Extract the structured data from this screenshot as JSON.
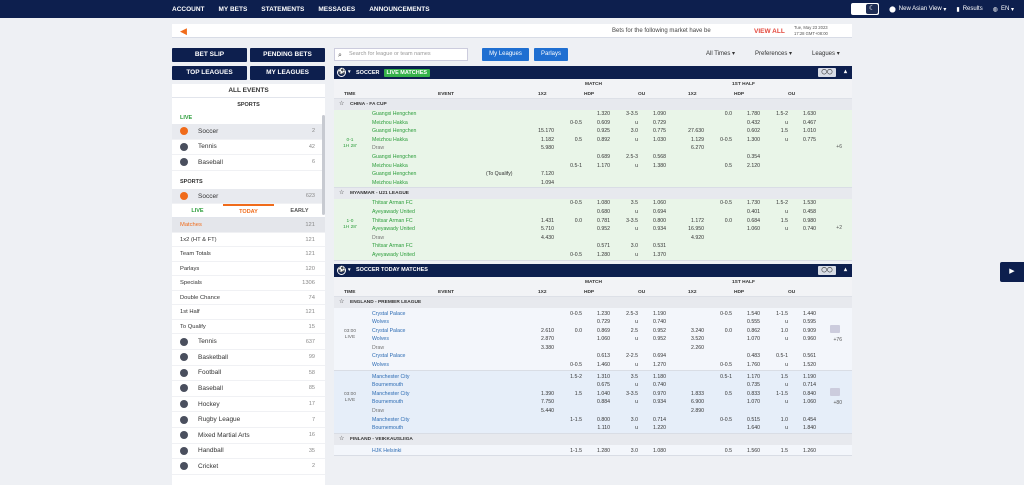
{
  "nav": {
    "items": [
      "ACCOUNT",
      "MY BETS",
      "STATEMENTS",
      "MESSAGES",
      "ANNOUNCEMENTS"
    ]
  },
  "topright": {
    "view": "New Asian View",
    "results": "Results",
    "lang": "EN"
  },
  "notice": {
    "text": "Bets for the following market have be",
    "view_all": "VIEW ALL",
    "date": "Tue, May 23 2023",
    "time": "17:28 GMT+08:00"
  },
  "leftbuttons": {
    "bet_slip": "BET SLIP",
    "pending_bets": "PENDING BETS",
    "top_leagues": "TOP LEAGUES",
    "my_leagues": "MY LEAGUES"
  },
  "filters": {
    "search_placeholder": "Search for league or team names",
    "my_leagues": "My Leagues",
    "parlays": "Parlays",
    "all_times": "All Times",
    "preferences": "Preferences",
    "leagues": "Leagues"
  },
  "sidebar": {
    "all_events": "ALL EVENTS",
    "sports_header": "SPORTS",
    "live_label": "LIVE",
    "live_sports": [
      {
        "name": "Soccer",
        "count": "2"
      },
      {
        "name": "Tennis",
        "count": "42"
      },
      {
        "name": "Baseball",
        "count": "6"
      }
    ],
    "sports_label": "SPORTS",
    "soccer": {
      "name": "Soccer",
      "count": "623"
    },
    "tabs": [
      "LIVE",
      "TODAY",
      "EARLY"
    ],
    "sub": [
      {
        "name": "Matches",
        "count": "121"
      },
      {
        "name": "1x2 (HT & FT)",
        "count": "121"
      },
      {
        "name": "Team Totals",
        "count": "121"
      },
      {
        "name": "Parlays",
        "count": "120"
      },
      {
        "name": "Specials",
        "count": "1306"
      },
      {
        "name": "Double Chance",
        "count": "74"
      },
      {
        "name": "1st Half",
        "count": "121"
      },
      {
        "name": "To Qualify",
        "count": "15"
      }
    ],
    "more_sports": [
      {
        "name": "Tennis",
        "count": "637"
      },
      {
        "name": "Basketball",
        "count": "99"
      },
      {
        "name": "Football",
        "count": "58"
      },
      {
        "name": "Baseball",
        "count": "85"
      },
      {
        "name": "Hockey",
        "count": "17"
      },
      {
        "name": "Rugby League",
        "count": "7"
      },
      {
        "name": "Mixed Martial Arts",
        "count": "16"
      },
      {
        "name": "Handball",
        "count": "35"
      },
      {
        "name": "Cricket",
        "count": "2"
      }
    ]
  },
  "live_section": {
    "title": "SOCCER",
    "badge": "LIVE MATCHES"
  },
  "today_section": {
    "title": "SOCCER TODAY MATCHES"
  },
  "headers": {
    "time": "TIME",
    "event": "EVENT",
    "match": "MATCH",
    "first_half": "1ST HALF",
    "x12": "1X2",
    "hdp": "HDP",
    "ou": "OU"
  },
  "live_leagues": [
    {
      "name": "CHINA - FA CUP",
      "score": "0-1",
      "clock": "1H 28'",
      "more": "+6",
      "rows": [
        [
          "Guangxi Hengchen",
          "",
          "",
          "1.320",
          "3-3.5",
          "1.090",
          "",
          "0.0",
          "1.780",
          "1.5-2",
          "1.630"
        ],
        [
          "Meizhou Hakka",
          "",
          "0-0.5",
          "0.609",
          "u",
          "0.729",
          "",
          "",
          "0.432",
          "u",
          "0.467"
        ],
        [
          "Guangxi Hengchen",
          "15.170",
          "",
          "0.925",
          "3.0",
          "0.775",
          "27.630",
          "",
          "0.602",
          "1.5",
          "1.010"
        ],
        [
          "Meizhou Hakka",
          "1.182",
          "0.5",
          "0.892",
          "u",
          "1.030",
          "1.129",
          "0-0.5",
          "1.300",
          "u",
          "0.775"
        ],
        [
          "Draw",
          "5.980",
          "",
          "",
          "",
          "",
          "6.270",
          "",
          "",
          "",
          ""
        ],
        [
          "Guangxi Hengchen",
          "",
          "",
          "0.689",
          "2.5-3",
          "0.568",
          "",
          "",
          "0.354",
          "",
          ""
        ],
        [
          "Meizhou Hakka",
          "",
          "0.5-1",
          "1.170",
          "u",
          "1.380",
          "",
          "0.5",
          "2.120",
          "",
          ""
        ],
        [
          "Guangxi Hengchen",
          "7.120",
          "",
          "",
          "",
          "",
          "",
          "",
          "",
          "",
          ""
        ],
        [
          "Meizhou Hakka",
          "1.094",
          "",
          "",
          "",
          "",
          "",
          "",
          "",
          "",
          ""
        ]
      ],
      "qualify": "(To Qualify)"
    },
    {
      "name": "MYANMAR - U21 LEAGUE",
      "score": "1-0",
      "clock": "1H 28'",
      "more": "+2",
      "rows": [
        [
          "Thitsar Arman FC",
          "",
          "0-0.5",
          "1.080",
          "3.5",
          "1.060",
          "",
          "0-0.5",
          "1.730",
          "1.5-2",
          "1.530"
        ],
        [
          "Ayeyawady United",
          "",
          "",
          "0.680",
          "u",
          "0.694",
          "",
          "",
          "0.401",
          "u",
          "0.458"
        ],
        [
          "Thitsar Arman FC",
          "1.431",
          "0.0",
          "0.781",
          "3-3.5",
          "0.800",
          "1.172",
          "0.0",
          "0.684",
          "1.5",
          "0.980"
        ],
        [
          "Ayeyawady United",
          "5.710",
          "",
          "0.952",
          "u",
          "0.934",
          "16.950",
          "",
          "1.060",
          "u",
          "0.740"
        ],
        [
          "Draw",
          "4.430",
          "",
          "",
          "",
          "",
          "4.920",
          "",
          "",
          "",
          ""
        ],
        [
          "Thitsar Arman FC",
          "",
          "",
          "0.571",
          "3.0",
          "0.531",
          "",
          "",
          "",
          "",
          ""
        ],
        [
          "Ayeyawady United",
          "",
          "0-0.5",
          "1.280",
          "u",
          "1.370",
          "",
          "",
          "",
          "",
          ""
        ]
      ]
    }
  ],
  "today_leagues": [
    {
      "name": "ENGLAND - PREMIER LEAGUE",
      "groups": [
        {
          "time": "03:00",
          "live": "LIVE",
          "more": "+76",
          "rows": [
            [
              "Crystal Palace",
              "",
              "0-0.5",
              "1.230",
              "2.5-3",
              "1.190",
              "",
              "0-0.5",
              "1.540",
              "1-1.5",
              "1.440"
            ],
            [
              "Wolves",
              "",
              "",
              "0.729",
              "u",
              "0.740",
              "",
              "",
              "0.555",
              "u",
              "0.595"
            ],
            [
              "Crystal Palace",
              "2.610",
              "0.0",
              "0.869",
              "2.5",
              "0.952",
              "3.240",
              "0.0",
              "0.862",
              "1.0",
              "0.909"
            ],
            [
              "Wolves",
              "2.870",
              "",
              "1.060",
              "u",
              "0.952",
              "3.520",
              "",
              "1.070",
              "u",
              "0.960"
            ],
            [
              "Draw",
              "3.380",
              "",
              "",
              "",
              "",
              "2.260",
              "",
              "",
              "",
              ""
            ],
            [
              "Crystal Palace",
              "",
              "",
              "0.613",
              "2-2.5",
              "0.694",
              "",
              "",
              "0.483",
              "0.5-1",
              "0.561"
            ],
            [
              "Wolves",
              "",
              "0-0.5",
              "1.460",
              "u",
              "1.270",
              "",
              "0-0.5",
              "1.760",
              "u",
              "1.520"
            ]
          ]
        },
        {
          "time": "03:00",
          "live": "LIVE",
          "more": "+80",
          "rows": [
            [
              "Manchester City",
              "",
              "1.5-2",
              "1.310",
              "3.5",
              "1.180",
              "",
              "0.5-1",
              "1.170",
              "1.5",
              "1.190"
            ],
            [
              "Bournemouth",
              "",
              "",
              "0.675",
              "u",
              "0.740",
              "",
              "",
              "0.735",
              "u",
              "0.714"
            ],
            [
              "Manchester City",
              "1.390",
              "1.5",
              "1.040",
              "3-3.5",
              "0.970",
              "1.833",
              "0.5",
              "0.833",
              "1-1.5",
              "0.840"
            ],
            [
              "Bournemouth",
              "7.750",
              "",
              "0.884",
              "u",
              "0.934",
              "6.900",
              "",
              "1.070",
              "u",
              "1.060"
            ],
            [
              "Draw",
              "5.440",
              "",
              "",
              "",
              "",
              "2.890",
              "",
              "",
              "",
              ""
            ],
            [
              "Manchester City",
              "",
              "1-1.5",
              "0.800",
              "3.0",
              "0.714",
              "",
              "0-0.5",
              "0.515",
              "1.0",
              "0.454"
            ],
            [
              "Bournemouth",
              "",
              "",
              "1.110",
              "u",
              "1.220",
              "",
              "",
              "1.640",
              "u",
              "1.840"
            ]
          ]
        }
      ]
    },
    {
      "name": "FINLAND - VEIKKAUSLIIGA",
      "groups": [
        {
          "time": "",
          "live": "",
          "more": "",
          "rows": [
            [
              "HJK Helsinki",
              "",
              "1-1.5",
              "1.280",
              "3.0",
              "1.080",
              "",
              "0.5",
              "1.560",
              "1.5",
              "1.260"
            ]
          ]
        }
      ]
    }
  ]
}
